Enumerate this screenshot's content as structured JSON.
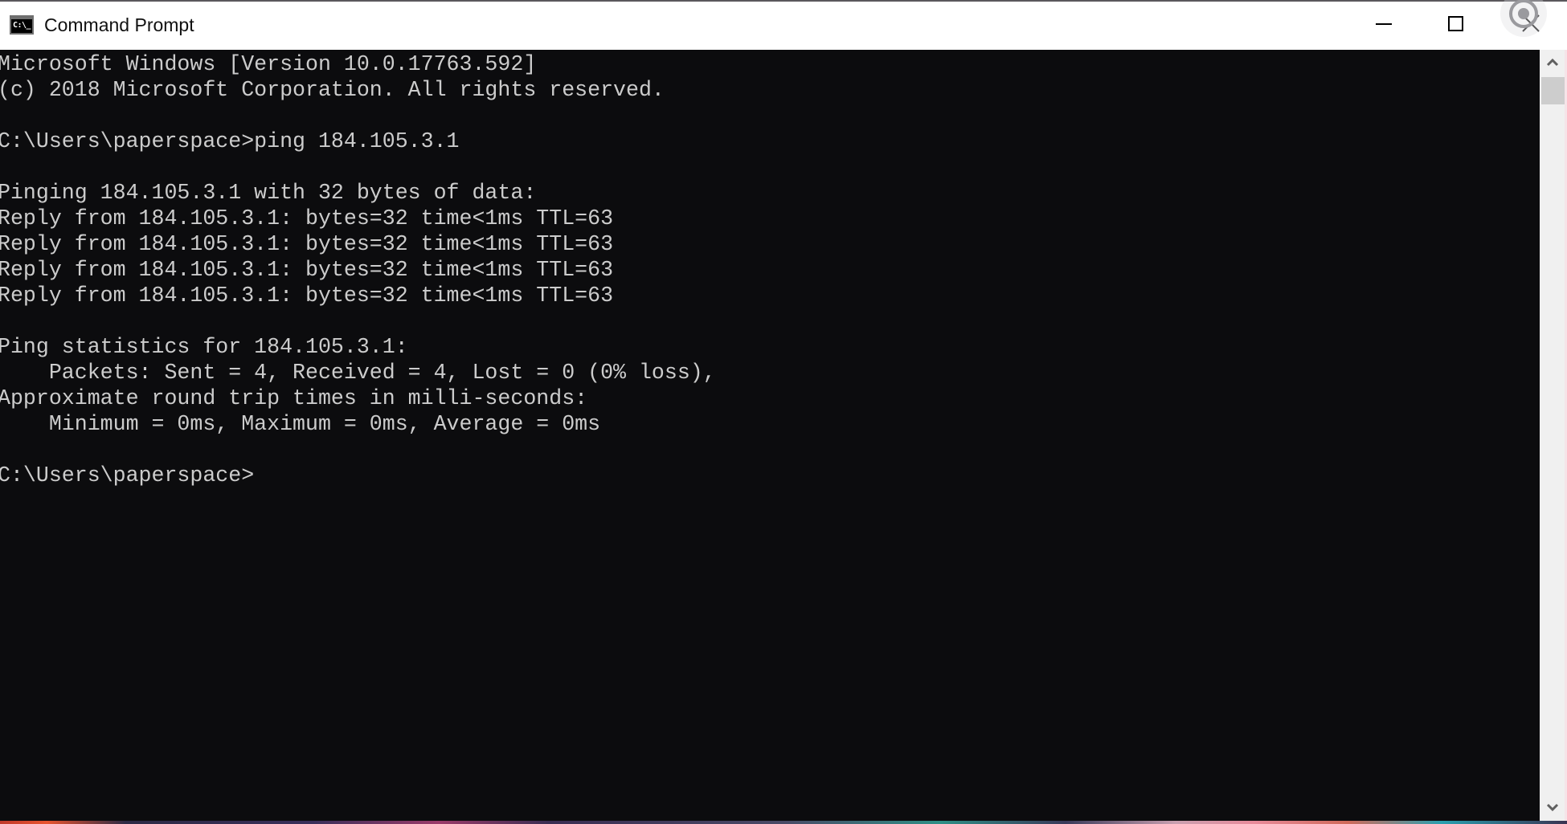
{
  "window": {
    "title": "Command Prompt",
    "icon": "cmd-icon",
    "icon_text": "C:\\_",
    "controls": {
      "minimize": "minimize-icon",
      "maximize": "maximize-icon",
      "close": "close-icon"
    }
  },
  "terminal": {
    "lines": [
      "Microsoft Windows [Version 10.0.17763.592]",
      "(c) 2018 Microsoft Corporation. All rights reserved.",
      "",
      "C:\\Users\\paperspace>ping 184.105.3.1",
      "",
      "Pinging 184.105.3.1 with 32 bytes of data:",
      "Reply from 184.105.3.1: bytes=32 time<1ms TTL=63",
      "Reply from 184.105.3.1: bytes=32 time<1ms TTL=63",
      "Reply from 184.105.3.1: bytes=32 time<1ms TTL=63",
      "Reply from 184.105.3.1: bytes=32 time<1ms TTL=63",
      "",
      "Ping statistics for 184.105.3.1:",
      "    Packets: Sent = 4, Received = 4, Lost = 0 (0% loss),",
      "Approximate round trip times in milli-seconds:",
      "    Minimum = 0ms, Maximum = 0ms, Average = 0ms",
      "",
      "C:\\Users\\paperspace>"
    ],
    "prompt": "C:\\Users\\paperspace>",
    "colors": {
      "background": "#0c0c0e",
      "foreground": "#cccccc"
    }
  },
  "scrollbar": {
    "up_icon": "chevron-up-icon",
    "down_icon": "chevron-down-icon",
    "position_fraction": 0.0
  }
}
